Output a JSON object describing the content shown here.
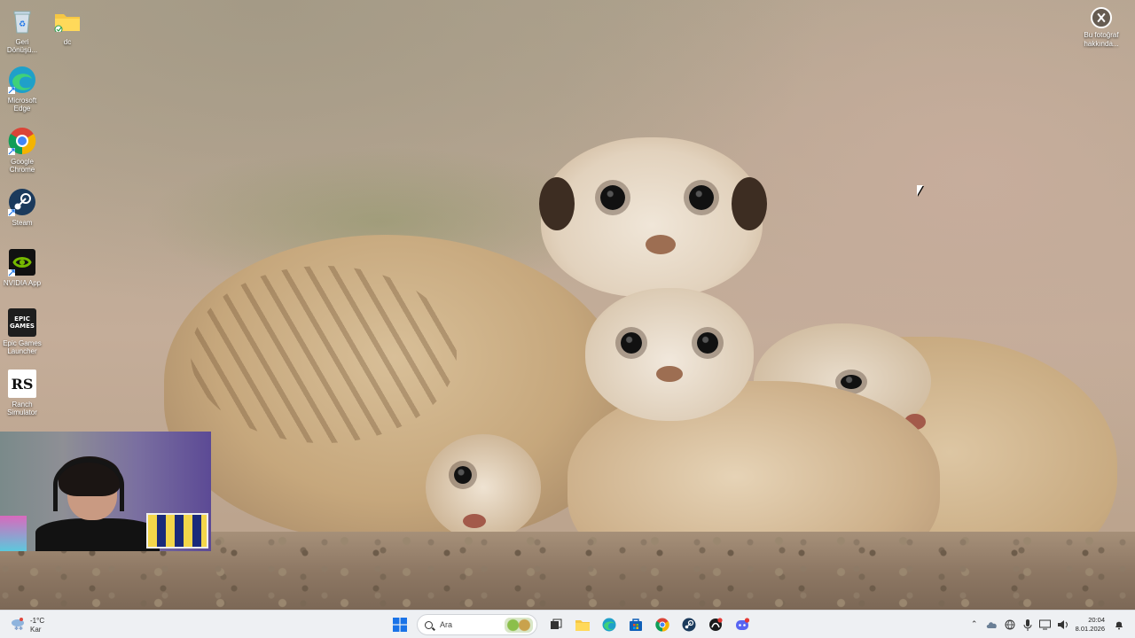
{
  "desktop": {
    "icons": [
      {
        "name": "recycle-bin",
        "label": "Geri Dönüşü..."
      },
      {
        "name": "folder-dc",
        "label": "dc"
      },
      {
        "name": "microsoft-edge",
        "label": "Microsoft Edge"
      },
      {
        "name": "google-chrome",
        "label": "Google Chrome"
      },
      {
        "name": "steam",
        "label": "Steam"
      },
      {
        "name": "nvidia-app",
        "label": "NVIDIA App"
      },
      {
        "name": "epic-games-launcher",
        "label": "Epic Games Launcher",
        "icon_text": "EPIC GAMES"
      },
      {
        "name": "ranch-simulator",
        "label": "Ranch Simulator",
        "icon_text": "RS"
      }
    ],
    "about_photo": {
      "label": "Bu fotoğraf hakkında..."
    }
  },
  "taskbar": {
    "weather": {
      "temp": "-1°C",
      "condition": "Kar"
    },
    "search": {
      "placeholder": "Ara"
    },
    "apps": [
      "start-icon",
      "search",
      "task-view-icon",
      "file-explorer-icon",
      "edge-icon",
      "microsoft-store-icon",
      "chrome-icon",
      "steam-icon",
      "app-icon",
      "discord-icon"
    ],
    "clock": {
      "time": "20:04",
      "date": "8.01.2026"
    }
  },
  "colors": {
    "taskbar_bg": "#eef0f3",
    "start_blue": "#1a73e8",
    "edge_teal": "#1fa0c9",
    "discord": "#5865f2",
    "nvidia": "#76b900"
  }
}
